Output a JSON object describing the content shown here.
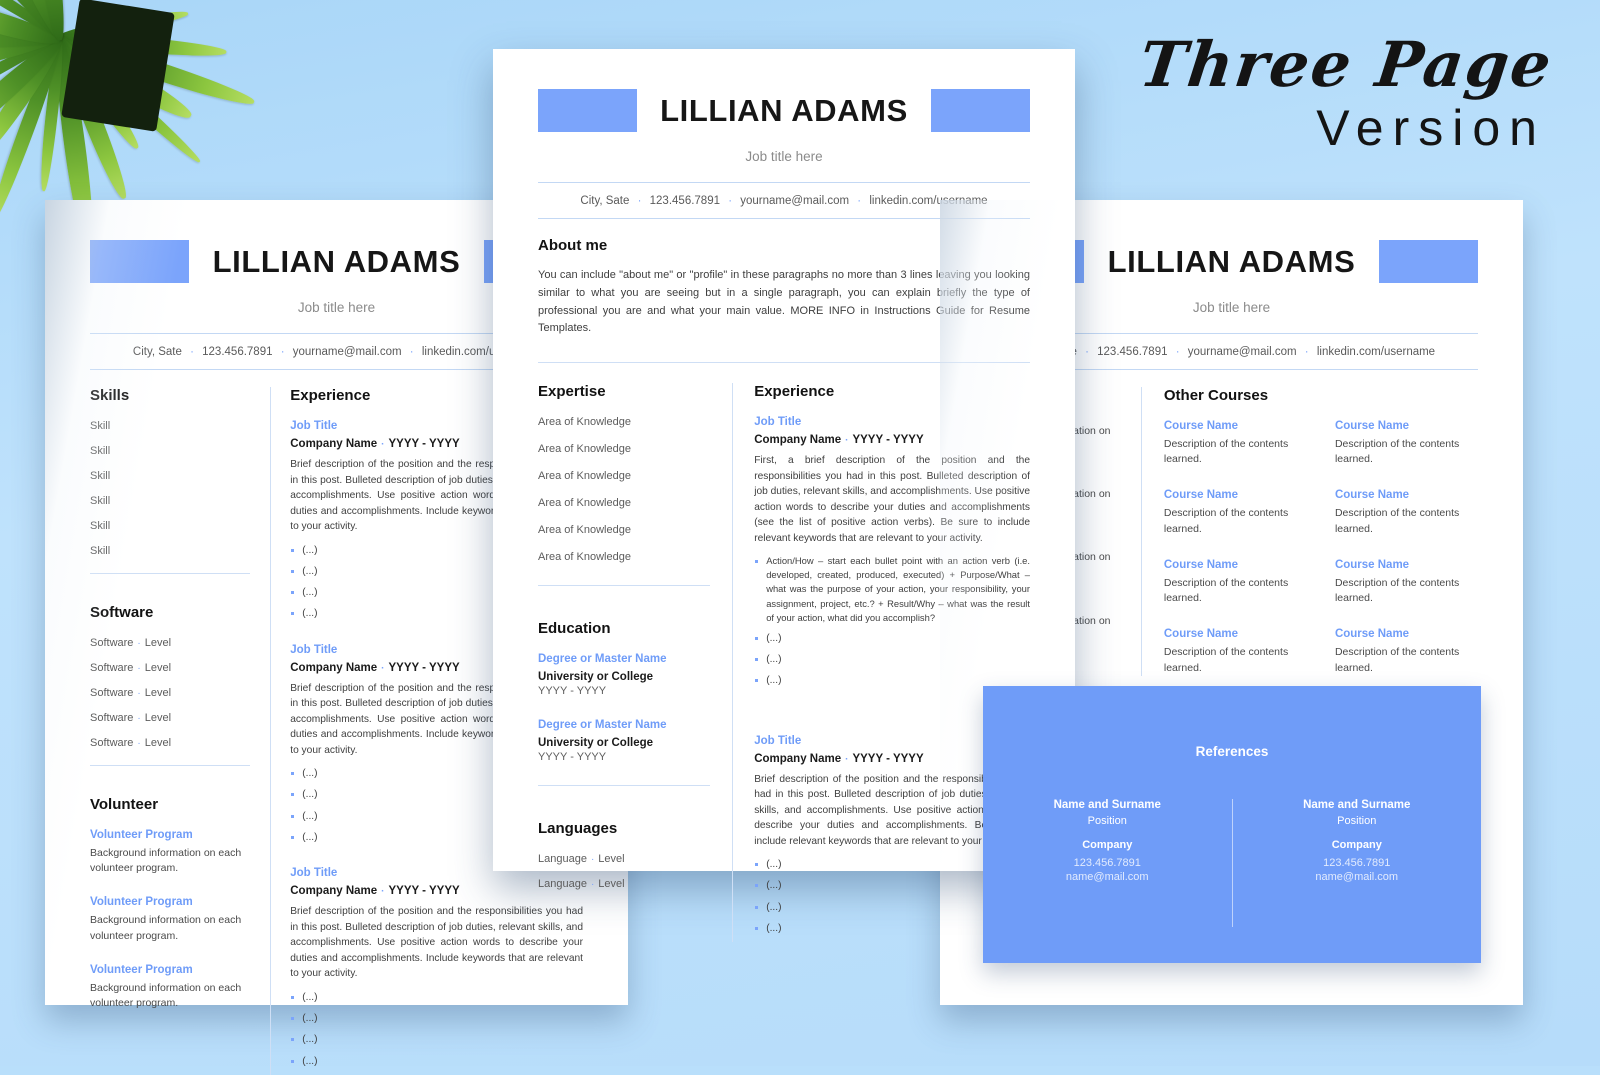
{
  "promo": {
    "line1": "Three Page",
    "line2": "Version"
  },
  "resume": {
    "name": "LILLIAN ADAMS",
    "job_title": "Job title here",
    "contact": {
      "city": "City, Sate",
      "phone": "123.456.7891",
      "email": "yourname@mail.com",
      "linkedin": "linkedin.com/username",
      "separator": "·"
    }
  },
  "colors": {
    "accent_blue": "#7ba4fb",
    "label_blue": "#6f9cf8",
    "page_background": "#b9dffb",
    "rule_blue": "#c3d8f4"
  },
  "page_one": {
    "sections": {
      "skills": {
        "title": "Skills",
        "items": [
          "Skill",
          "Skill",
          "Skill",
          "Skill",
          "Skill",
          "Skill"
        ]
      },
      "software": {
        "title": "Software",
        "items": [
          {
            "name": "Software",
            "level": "Level"
          },
          {
            "name": "Software",
            "level": "Level"
          },
          {
            "name": "Software",
            "level": "Level"
          },
          {
            "name": "Software",
            "level": "Level"
          },
          {
            "name": "Software",
            "level": "Level"
          }
        ]
      },
      "volunteer": {
        "title": "Volunteer",
        "items": [
          {
            "program": "Volunteer Program",
            "description": "Background information on each volunteer program."
          },
          {
            "program": "Volunteer Program",
            "description": "Background information on each volunteer program."
          },
          {
            "program": "Volunteer Program",
            "description": "Background information on each volunteer program."
          }
        ]
      },
      "experience": {
        "title": "Experience",
        "jobs": [
          {
            "job_title": "Job Title",
            "company": "Company Name",
            "dates": "YYYY - YYYY",
            "description": "Brief description of the position and the responsibilities you had in this post. Bulleted description of job duties, relevant skills, and accomplishments. Use positive action words to describe your duties and accomplishments. Include keywords that are relevant to your activity.",
            "bullets": [
              "(...)",
              "(...)",
              "(...)",
              "(...)"
            ]
          },
          {
            "job_title": "Job Title",
            "company": "Company Name",
            "dates": "YYYY - YYYY",
            "description": "Brief description of the position and the responsibilities you had in this post. Bulleted description of job duties, relevant skills, and accomplishments. Use positive action words to describe your duties and accomplishments. Include keywords that are relevant to your activity.",
            "bullets": [
              "(...)",
              "(...)",
              "(...)",
              "(...)"
            ]
          },
          {
            "job_title": "Job Title",
            "company": "Company Name",
            "dates": "YYYY - YYYY",
            "description": "Brief description of the position and the responsibilities you had in this post. Bulleted description of job duties, relevant skills, and accomplishments. Use positive action words to describe your duties and accomplishments. Include keywords that are relevant to your activity.",
            "bullets": [
              "(...)",
              "(...)",
              "(...)",
              "(...)"
            ]
          }
        ]
      }
    }
  },
  "page_two": {
    "about": {
      "title": "About me",
      "text": "You can include \"about me\" or \"profile\" in these paragraphs no more than 3 lines leaving you looking similar to what you are seeing but in a single paragraph, you can explain briefly the type of professional you are and what your main value. MORE INFO in Instructions Guide for Resume Templates."
    },
    "expertise": {
      "title": "Expertise",
      "items": [
        "Area of Knowledge",
        "Area of Knowledge",
        "Area of Knowledge",
        "Area of Knowledge",
        "Area of Knowledge",
        "Area of Knowledge"
      ]
    },
    "education": {
      "title": "Education",
      "items": [
        {
          "degree": "Degree or Master Name",
          "school": "University or College",
          "dates": "YYYY - YYYY"
        },
        {
          "degree": "Degree or Master Name",
          "school": "University or College",
          "dates": "YYYY - YYYY"
        }
      ]
    },
    "languages": {
      "title": "Languages",
      "items": [
        {
          "name": "Language",
          "level": "Level"
        },
        {
          "name": "Language",
          "level": "Level"
        }
      ]
    },
    "experience": {
      "title": "Experience",
      "jobs": [
        {
          "job_title": "Job Title",
          "company": "Company Name",
          "dates": "YYYY - YYYY",
          "description": "First, a brief description of the position and the responsibilities you had in this post. Bulleted description of job duties, relevant skills, and accomplishments. Use positive action words to describe your duties and accomplishments (see the list of positive action verbs). Be sure to include relevant keywords that are relevant to your activity.",
          "bullets": [
            "Action/How – start each bullet point with an action verb (i.e. developed, created, produced, executed) + Purpose/What – what was the purpose of your action, your responsibility, your assignment, project, etc.? + Result/Why – what was the result of your action, what did you accomplish?",
            "(...)",
            "(...)",
            "(...)"
          ]
        },
        {
          "job_title": "Job Title",
          "company": "Company Name",
          "dates": "YYYY - YYYY",
          "description": "Brief description of the position and the responsibilities you had in this post. Bulleted description of job duties, relevant skills, and accomplishments. Use positive action words to describe your duties and accomplishments. Be sure to include relevant keywords that are relevant to your activity.",
          "bullets": [
            "(...)",
            "(...)",
            "(...)",
            "(...)"
          ]
        }
      ]
    }
  },
  "page_three": {
    "hidden_column": {
      "items": [
        "Background information on",
        "Background information on",
        "Background information on",
        "Background information on"
      ]
    },
    "other_courses": {
      "title": "Other Courses",
      "items": [
        {
          "name": "Course Name",
          "description": "Description of the contents learned."
        },
        {
          "name": "Course Name",
          "description": "Description of the contents learned."
        },
        {
          "name": "Course Name",
          "description": "Description of the contents learned."
        },
        {
          "name": "Course Name",
          "description": "Description of the contents learned."
        },
        {
          "name": "Course Name",
          "description": "Description of the contents learned."
        },
        {
          "name": "Course Name",
          "description": "Description of the contents learned."
        },
        {
          "name": "Course Name",
          "description": "Description of the contents learned."
        },
        {
          "name": "Course Name",
          "description": "Description of the contents learned."
        }
      ]
    },
    "references": {
      "title": "References",
      "items": [
        {
          "name": "Name and Surname",
          "position": "Position",
          "company": "Company",
          "phone": "123.456.7891",
          "email": "name@mail.com"
        },
        {
          "name": "Name and Surname",
          "position": "Position",
          "company": "Company",
          "phone": "123.456.7891",
          "email": "name@mail.com"
        }
      ]
    }
  }
}
